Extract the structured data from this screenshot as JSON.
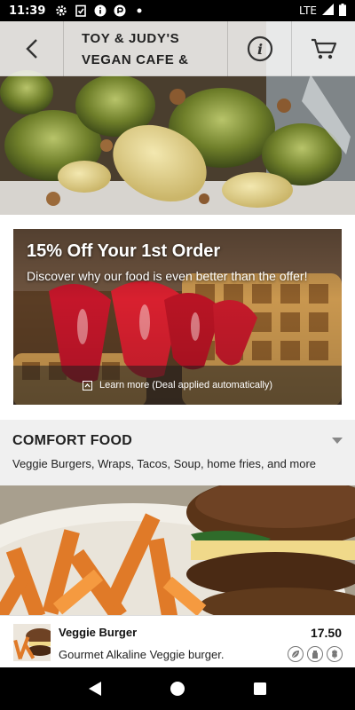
{
  "status_bar": {
    "time": "11:39",
    "network": "LTE",
    "icons": [
      "gear-icon",
      "clipboard-check-icon",
      "info-icon",
      "privacy-icon",
      "dot-icon"
    ]
  },
  "header": {
    "title_line1": "TOY & JUDY'S",
    "title_line2": "VEGAN CAFE &"
  },
  "promo": {
    "title": "15% Off Your 1st Order",
    "subtitle": "Discover why our food is even better than the offer!",
    "learn_more": "Learn more (Deal applied automatically)"
  },
  "category": {
    "title": "COMFORT FOOD",
    "description": "Veggie Burgers, Wraps, Tacos, Soup, home fries, and more"
  },
  "item": {
    "name": "Veggie Burger",
    "description": "Gourmet Alkaline Veggie burger.",
    "price": "17.50",
    "tags": [
      "vegan-leaf-icon",
      "dairy-free-icon",
      "gluten-free-icon"
    ]
  },
  "colors": {
    "status_bar": "#000000",
    "category_bg": "#f0f0f0",
    "text_dark": "#222222"
  }
}
